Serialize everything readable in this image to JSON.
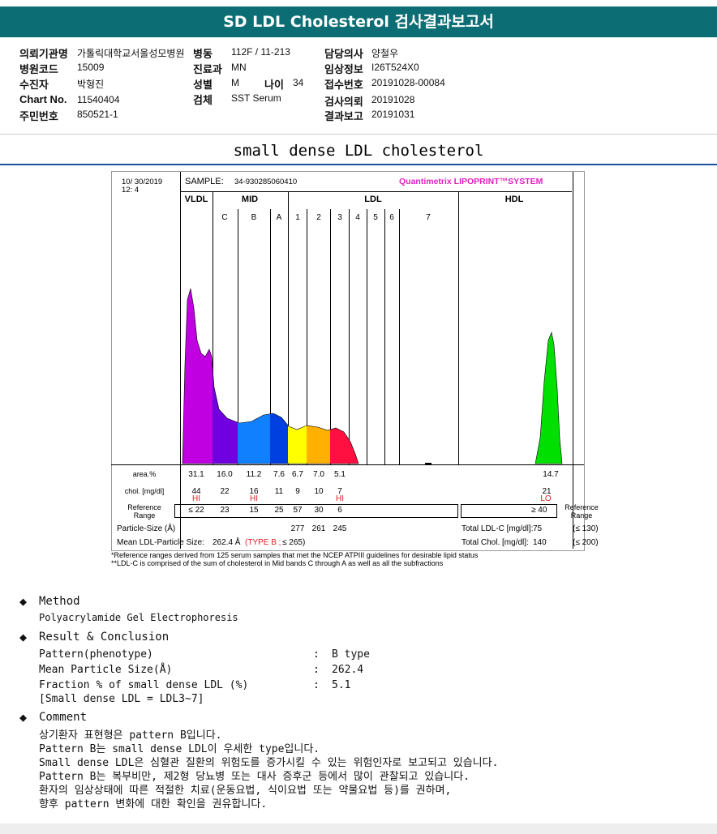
{
  "title": "SD LDL Cholesterol 검사결과보고서",
  "info": {
    "institution_label": "의뢰기관명",
    "institution": "가톨릭대학교서울성모병원",
    "ward_label": "병동",
    "ward": "112F / 11-213",
    "doctor_label": "담당의사",
    "doctor": "양철우",
    "hospcode_label": "병원코드",
    "hospcode": "15009",
    "dept_label": "진료과",
    "dept": "MN",
    "clinical_label": "임상정보",
    "clinical": "I26T524X0",
    "patient_label": "수진자",
    "patient": "박형진",
    "sex_label": "성별",
    "sex": "M",
    "age_label": "나이",
    "age": "34",
    "receipt_label": "접수번호",
    "receipt": "20191028-00084",
    "chart_label": "Chart No.",
    "chart": "11540404",
    "specimen_label": "검체",
    "specimen": "SST Serum",
    "request_label": "검사의뢰",
    "request": "20191028",
    "id_label": "주민번호",
    "id": "850521-1",
    "report_label": "결과보고",
    "report": "20191031"
  },
  "subtitle": "small dense LDL cholesterol",
  "lipoprint": {
    "date": "10/ 30/2019",
    "time": "12: 4",
    "sample_label": "SAMPLE:",
    "sample": "34-930285060410",
    "brand": "Quantimetrix LIPOPRINT™SYSTEM",
    "groups": [
      "VLDL",
      "MID",
      "LDL",
      "HDL"
    ],
    "bands": [
      "C",
      "B",
      "A",
      "1",
      "2",
      "3",
      "4",
      "5",
      "6",
      "7"
    ],
    "area_label": "area.%",
    "area": [
      "31.1",
      "16.0",
      "11.2",
      "7.6",
      "6.7",
      "7.0",
      "5.1"
    ],
    "area_hdl": "14.7",
    "chol_label": "chol. [mg/dl]",
    "chol": [
      "44",
      "22",
      "16",
      "11",
      "9",
      "10",
      "7"
    ],
    "chol_hdl": "21",
    "flags": [
      "HI",
      "",
      "HI",
      "",
      "",
      "",
      "HI"
    ],
    "flag_hdl": "LO",
    "ref_label": "Reference Range",
    "ref": [
      "≤ 22",
      "23",
      "15",
      "25",
      "57",
      "30",
      "6"
    ],
    "ref_hdl": "≥ 40",
    "ps_label": "Particle-Size (Å)",
    "ps": [
      "277",
      "261",
      "245"
    ],
    "mean_label": "Mean LDL-Particle Size:",
    "mean": "262.4 Å",
    "mean_type": "(TYPE B ;",
    "mean_ref": "≤ 265)",
    "total_ldl_label": "Total LDL-C [mg/dl]:",
    "total_ldl": "75",
    "total_ldl_ref": "(≤ 130)",
    "total_chol_label": "Total Chol. [mg/dl]:",
    "total_chol": "140",
    "total_chol_ref": "(≤ 200)",
    "note1": "*Reference ranges derived from 125 serum samples that met the NCEP ATPIII guidelines for desirable lipid status",
    "note2": "**LDL-C is comprised of the sum of cholesterol in Mid bands C through A as well as all the subfractions",
    "colors": {
      "vldl": "#c000e0",
      "c": "#7000e0",
      "b": "#1080ff",
      "a": "#0040e0",
      "l1": "#ffff00",
      "l2": "#ffb000",
      "l3": "#ff1040",
      "hdl": "#00e000"
    }
  },
  "method": {
    "heading": "Method",
    "text": "Polyacrylamide Gel Electrophoresis"
  },
  "result": {
    "heading": "Result & Conclusion",
    "rows": [
      {
        "k": "Pattern(phenotype)",
        "v": "B type"
      },
      {
        "k": "Mean Particle Size(Å)",
        "v": "262.4"
      },
      {
        "k": "Fraction % of small dense LDL (%)",
        "v": "5.1"
      }
    ],
    "note": "[Small dense LDL = LDL3~7]",
    "sep": ":"
  },
  "comment": {
    "heading": "Comment",
    "lines": [
      "상기환자 표현형은 pattern B입니다.",
      "Pattern B는 small dense LDL이 우세한 type입니다.",
      "Small dense LDL은 심혈관 질환의 위험도를 증가시킬 수 있는 위험인자로 보고되고 있습니다.",
      "Pattern B는 복부비만, 제2형 당뇨병 또는 대사 증후군 등에서 많이 관찰되고 있습니다.",
      "환자의 임상상태에 따른 적절한 치료(운동요법, 식이요법 또는 약물요법 등)를 권하며,",
      "향후 pattern 변화에 대한 확인을 권유합니다."
    ]
  }
}
